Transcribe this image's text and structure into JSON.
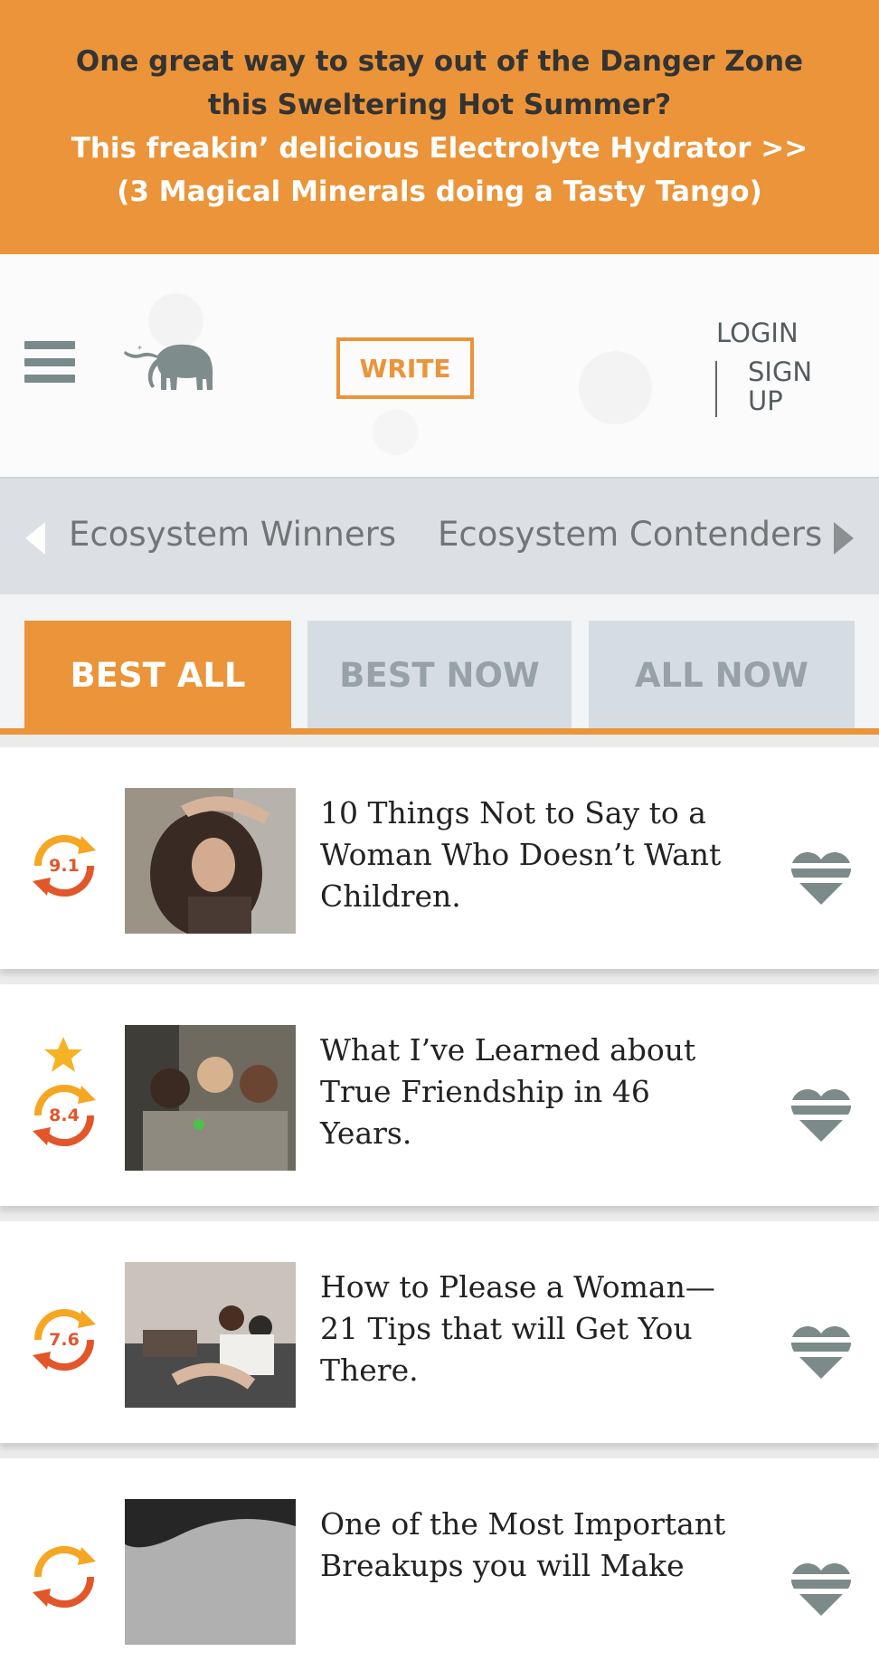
{
  "promo": {
    "line1": "One great way to stay out of the Danger Zone",
    "line2": "this Sweltering Hot Summer?",
    "link_line1": "This freakin’ delicious Electrolyte Hydrator >>",
    "link_line2": "(3 Magical Minerals doing a Tasty Tango)",
    "bg_color": "#eb9439"
  },
  "header": {
    "menu_icon": "hamburger-menu-icon",
    "logo_icon": "elephant-logo-icon",
    "write_label": "WRITE",
    "login_label": "LOGIN",
    "signup_label": "SIGN UP"
  },
  "categories": {
    "items": [
      "Ecosystem Winners",
      "Ecosystem Contenders"
    ],
    "prev_icon": "arrow-left-icon",
    "next_icon": "arrow-right-icon"
  },
  "tabs": [
    {
      "label": "BEST ALL",
      "active": true
    },
    {
      "label": "BEST NOW",
      "active": false
    },
    {
      "label": "ALL NOW",
      "active": false
    }
  ],
  "articles": [
    {
      "score": "9.1",
      "starred": false,
      "title": "10 Things Not to Say to a Woman Who Doesn’t Want Children."
    },
    {
      "score": "8.4",
      "starred": true,
      "title": "What I’ve Learned about True Friendship in 46 Years."
    },
    {
      "score": "7.6",
      "starred": false,
      "title": "How to Please a Woman—21 Tips that will Get You There."
    },
    {
      "score": "",
      "starred": false,
      "title": "One of the Most Important Breakups you will Make"
    }
  ],
  "colors": {
    "accent": "#eb9439",
    "score_text": "#e2562a",
    "heart": "#7d8a8a",
    "tab_inactive": "#d6dde2"
  }
}
